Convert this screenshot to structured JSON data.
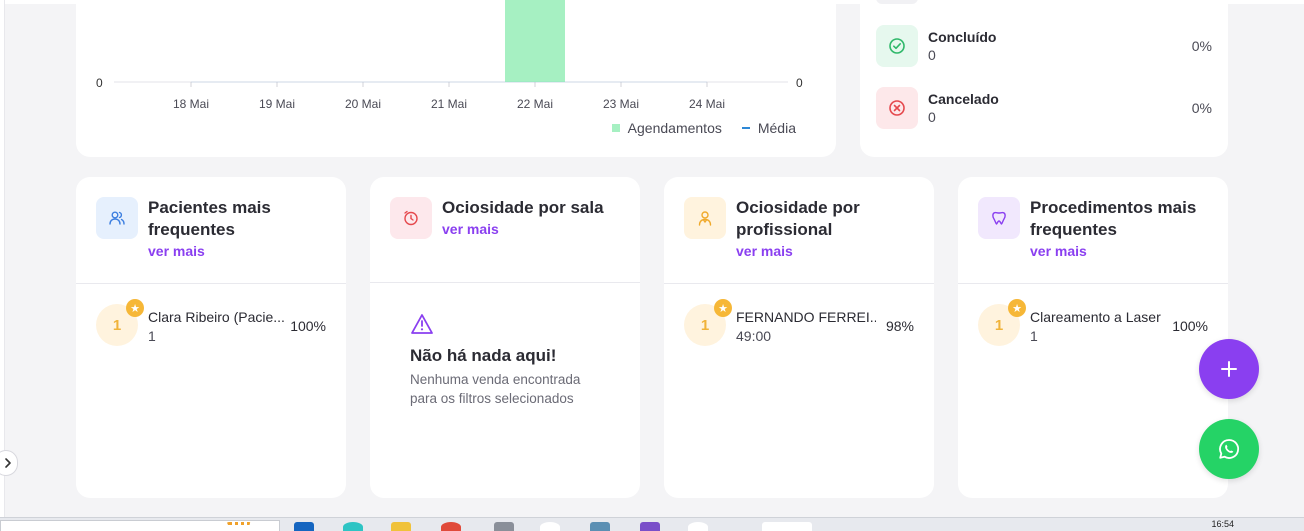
{
  "chart": {
    "dates": [
      "18 Mai",
      "19 Mai",
      "20 Mai",
      "21 Mai",
      "22 Mai",
      "23 Mai",
      "24 Mai"
    ],
    "left_axis_zero": "0",
    "right_axis_zero": "0",
    "legend": {
      "bars": "Agendamentos",
      "line": "Média"
    },
    "colors": {
      "bar": "#a6f0c2",
      "line": "#2e88d6"
    }
  },
  "chart_data": {
    "type": "bar",
    "categories": [
      "18 Mai",
      "19 Mai",
      "20 Mai",
      "21 Mai",
      "22 Mai",
      "23 Mai",
      "24 Mai"
    ],
    "series": [
      {
        "name": "Agendamentos",
        "values": [
          0,
          0,
          0,
          0,
          1,
          0,
          0
        ]
      },
      {
        "name": "Média",
        "values": [
          0,
          0,
          0,
          0,
          0,
          0,
          0
        ]
      }
    ],
    "title": "",
    "xlabel": "",
    "ylabel": "",
    "grid": false,
    "legend": "bottom-right"
  },
  "status": {
    "items": [
      {
        "title": "Concluído",
        "count": "0",
        "pct": "0%",
        "icon": "check-circle-icon",
        "color": "#2fb86a",
        "bg": "#e6f8ee"
      },
      {
        "title": "Cancelado",
        "count": "0",
        "pct": "0%",
        "icon": "x-circle-icon",
        "color": "#e5484d",
        "bg": "#fde8ea"
      }
    ]
  },
  "cards": {
    "pacientes": {
      "title": "Pacientes mais frequentes",
      "link": "ver mais",
      "rank": "1",
      "name": "Clara Ribeiro (Pacie...",
      "sub": "1",
      "pct": "100%"
    },
    "sala": {
      "title": "Ociosidade por sala",
      "link": "ver mais",
      "empty_title": "Não há nada aqui!",
      "empty_desc": "Nenhuma venda encontrada para os filtros selecionados"
    },
    "profissional": {
      "title": "Ociosidade por profissional",
      "link": "ver mais",
      "rank": "1",
      "name": "FERNANDO FERREI...",
      "sub": "49:00",
      "pct": "98%"
    },
    "procedimentos": {
      "title": "Procedimentos mais frequentes",
      "link": "ver mais",
      "rank": "1",
      "name": "Clareamento a Laser",
      "sub": "1",
      "pct": "100%"
    }
  },
  "fab": {
    "add": "+"
  },
  "taskbar": {
    "clock": "16:54"
  },
  "colors": {
    "accent": "#8a3ff0",
    "whatsapp": "#25d366",
    "rank": "#f0b33a"
  }
}
